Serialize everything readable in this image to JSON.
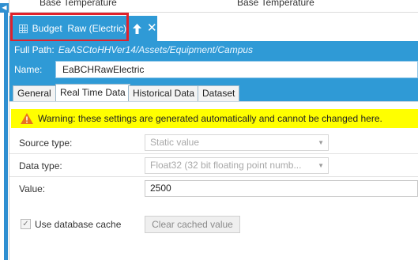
{
  "background": {
    "text_left": "Base Temperature",
    "text_right": "Base Temperature"
  },
  "document_tab": {
    "title": "Budget  Raw (Electric)",
    "pin_icon": "pin-icon",
    "close_icon": "close-icon"
  },
  "path": {
    "label": "Full Path:",
    "value": "EaASCtoHHVer14/Assets/Equipment/Campus"
  },
  "name": {
    "label": "Name:",
    "value": "EaBCHRawElectric"
  },
  "tabs": [
    {
      "label": "General",
      "active": false
    },
    {
      "label": "Real Time Data",
      "active": true
    },
    {
      "label": "Historical Data",
      "active": false
    },
    {
      "label": "Dataset",
      "active": false
    }
  ],
  "warning": {
    "text": "Warning: these settings are generated automatically and cannot be changed here."
  },
  "fields": {
    "source_type": {
      "label": "Source type:",
      "value": "Static value"
    },
    "data_type": {
      "label": "Data type:",
      "value": "Float32 (32 bit floating point numb..."
    },
    "value": {
      "label": "Value:",
      "value": "2500"
    }
  },
  "cache": {
    "label": "Use database cache",
    "checked": true,
    "button_label": "Clear cached value"
  },
  "colors": {
    "accent": "#2f9ad6",
    "warning": "#ffff00",
    "highlight": "#e0212b"
  }
}
